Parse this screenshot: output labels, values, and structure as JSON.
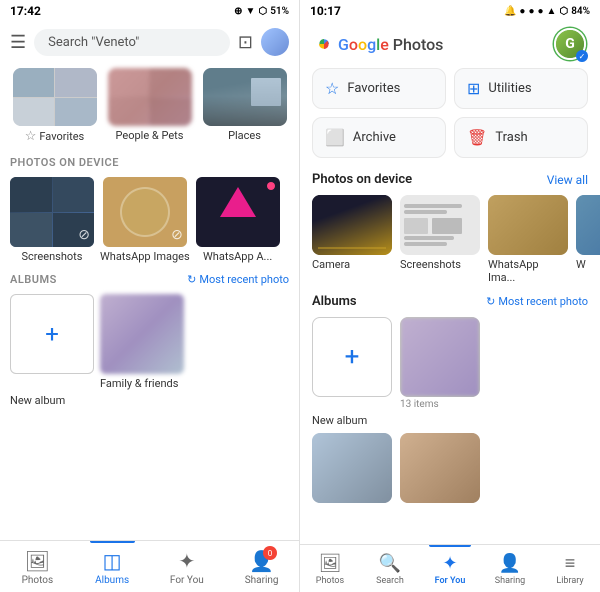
{
  "left": {
    "statusBar": {
      "time": "17:42",
      "icons": "⊕ ▼ ⬡ 51%"
    },
    "search": {
      "placeholder": "Search \"Veneto\""
    },
    "categories": [
      {
        "label": "Favorites",
        "icon": "☆",
        "type": "grid"
      },
      {
        "label": "People & Pets",
        "type": "grid"
      },
      {
        "label": "Places",
        "type": "single"
      }
    ],
    "photosOnDevice": {
      "sectionLabel": "PHOTOS ON DEVICE",
      "items": [
        {
          "label": "Screenshots",
          "thumbType": "screenshots"
        },
        {
          "label": "WhatsApp Images",
          "thumbType": "wa-img"
        },
        {
          "label": "WhatsApp A...",
          "thumbType": "wa-a"
        }
      ]
    },
    "albums": {
      "sectionLabel": "ALBUMS",
      "mostRecentLabel": "Most recent photo",
      "newAlbumLabel": "New album",
      "items": [
        {
          "label": "Family & friends",
          "thumbType": "family"
        }
      ]
    },
    "bottomNav": {
      "items": [
        {
          "label": "Photos",
          "icon": "⬜",
          "active": false
        },
        {
          "label": "Albums",
          "icon": "◫",
          "active": true
        },
        {
          "label": "For You",
          "icon": "✦",
          "active": false
        },
        {
          "label": "Sharing",
          "icon": "👤",
          "active": false,
          "badge": "0"
        }
      ]
    }
  },
  "right": {
    "statusBar": {
      "time": "10:17",
      "icons": "🔔 ● ● ● ▲ ⬡ 84%"
    },
    "header": {
      "title": "Google Photos",
      "titleParts": [
        "Google",
        " ",
        "Photos"
      ]
    },
    "quickActions": [
      {
        "label": "Favorites",
        "icon": "☆",
        "iconColor": "blue"
      },
      {
        "label": "Utilities",
        "icon": "⬛",
        "iconColor": "blue"
      },
      {
        "label": "Archive",
        "icon": "⬜",
        "iconColor": "blue"
      },
      {
        "label": "Trash",
        "icon": "🗑",
        "iconColor": "red"
      }
    ],
    "photosOnDevice": {
      "sectionLabel": "Photos on device",
      "viewAllLabel": "View all",
      "items": [
        {
          "label": "Camera",
          "thumbType": "camera"
        },
        {
          "label": "Screenshots",
          "thumbType": "screenshots-right"
        },
        {
          "label": "WhatsApp Ima...",
          "thumbType": "wa-right"
        },
        {
          "label": "W",
          "thumbType": "cut"
        }
      ]
    },
    "albums": {
      "sectionLabel": "Albums",
      "mostRecentLabel": "Most recent photo",
      "newAlbumLabel": "New album",
      "items": [
        {
          "label": "13 items",
          "thumbType": "family-right"
        }
      ]
    },
    "forYou": {
      "cards": [
        {
          "type": "card1"
        },
        {
          "type": "card2"
        }
      ]
    },
    "bottomNav": {
      "items": [
        {
          "label": "Photos",
          "icon": "⬜",
          "active": false
        },
        {
          "label": "Search",
          "icon": "🔍",
          "active": false
        },
        {
          "label": "For You",
          "icon": "✦",
          "active": true
        },
        {
          "label": "Sharing",
          "icon": "👤",
          "active": false
        },
        {
          "label": "Library",
          "icon": "≡",
          "active": false
        }
      ]
    }
  }
}
